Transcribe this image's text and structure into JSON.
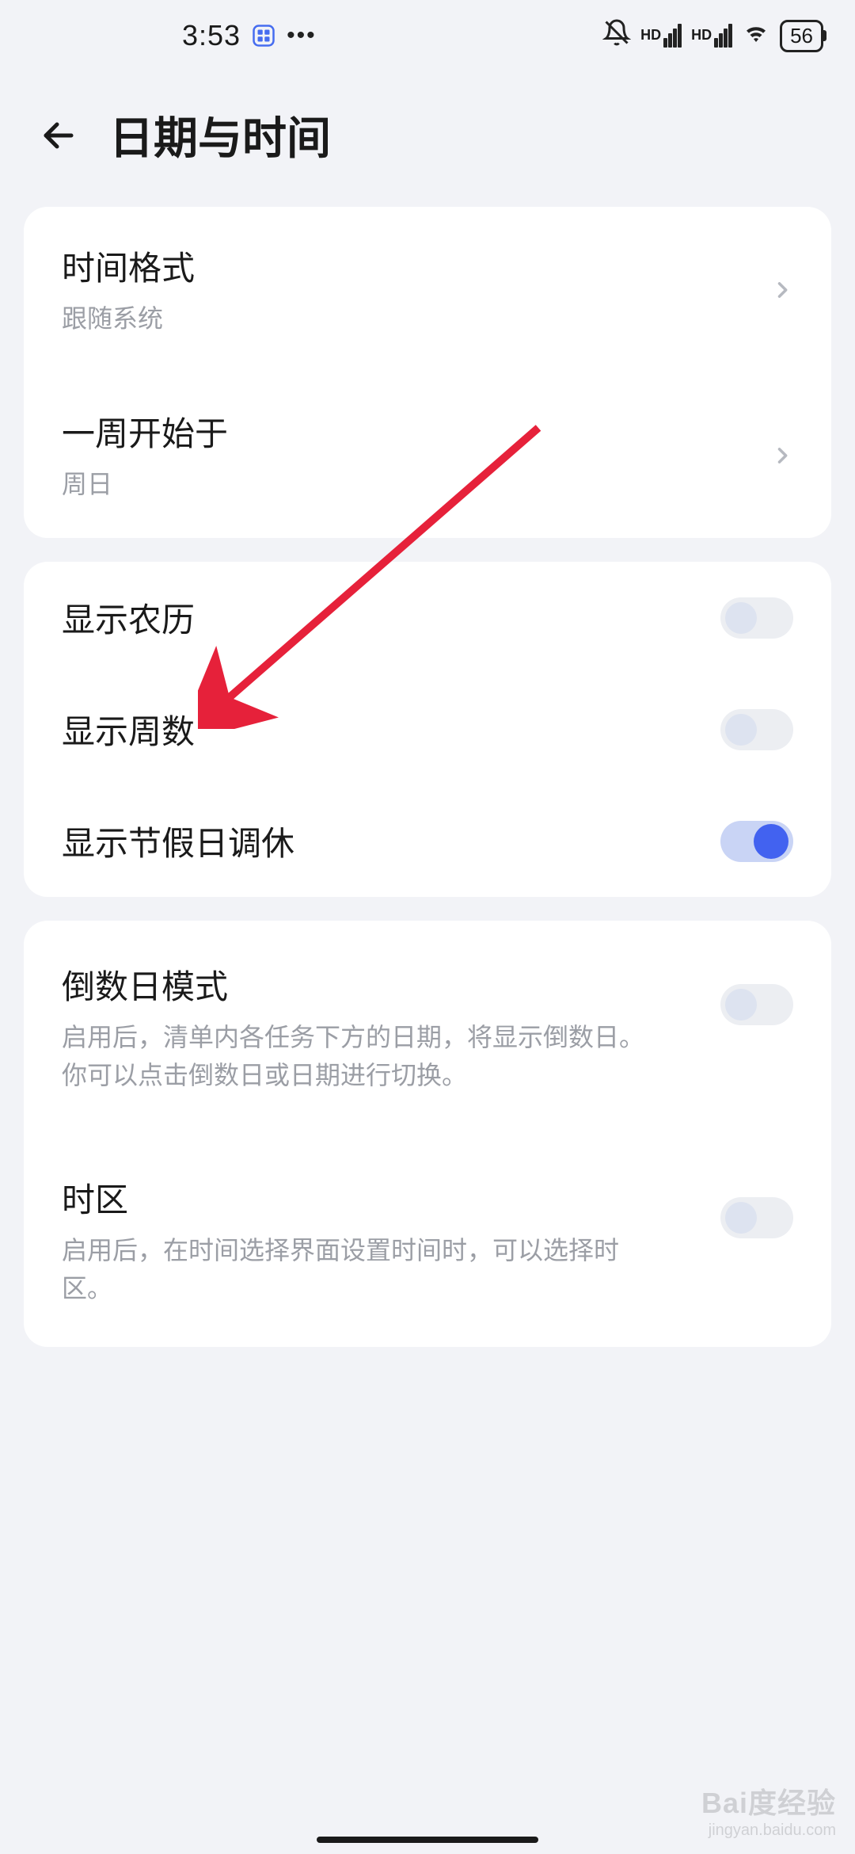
{
  "status": {
    "time": "3:53",
    "battery": "56"
  },
  "header": {
    "title": "日期与时间"
  },
  "group1": {
    "time_format": {
      "title": "时间格式",
      "sub": "跟随系统"
    },
    "week_start": {
      "title": "一周开始于",
      "sub": "周日"
    }
  },
  "group2": {
    "lunar": {
      "title": "显示农历"
    },
    "week_num": {
      "title": "显示周数"
    },
    "holiday": {
      "title": "显示节假日调休"
    }
  },
  "group3": {
    "countdown": {
      "title": "倒数日模式",
      "sub": "启用后，清单内各任务下方的日期，将显示倒数日。你可以点击倒数日或日期进行切换。"
    },
    "timezone": {
      "title": "时区",
      "sub": "启用后，在时间选择界面设置时间时，可以选择时区。"
    }
  },
  "watermark": {
    "main": "Bai度经验",
    "sub": "jingyan.baidu.com"
  }
}
